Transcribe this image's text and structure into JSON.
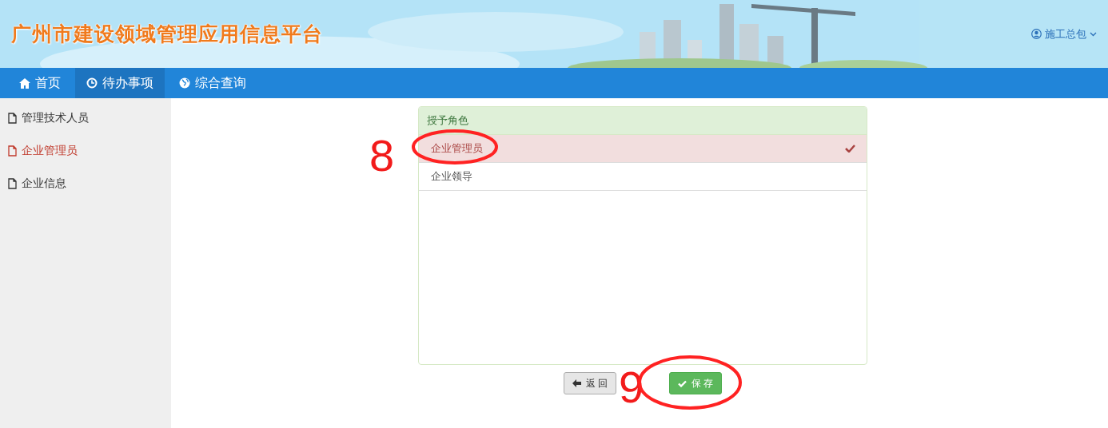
{
  "header": {
    "title": "广州市建设领域管理应用信息平台",
    "user": "施工总包"
  },
  "nav": [
    {
      "label": "首页",
      "kind": "home",
      "selected": false
    },
    {
      "label": "待办事项",
      "kind": "todo",
      "selected": true
    },
    {
      "label": "综合查询",
      "kind": "query",
      "selected": false
    }
  ],
  "sidebar": {
    "items": [
      {
        "label": "管理技术人员",
        "selected": false
      },
      {
        "label": "企业管理员",
        "selected": true
      },
      {
        "label": "企业信息",
        "selected": false
      }
    ]
  },
  "panel": {
    "title": "授予角色",
    "roles": [
      {
        "label": "企业管理员",
        "selected": true
      },
      {
        "label": "企业领导",
        "selected": false
      }
    ]
  },
  "buttons": [
    {
      "label": "返 回",
      "kind": "back"
    },
    {
      "label": "保 存",
      "kind": "save"
    }
  ],
  "annotations": [
    {
      "label": "8"
    },
    {
      "label": "9"
    }
  ]
}
